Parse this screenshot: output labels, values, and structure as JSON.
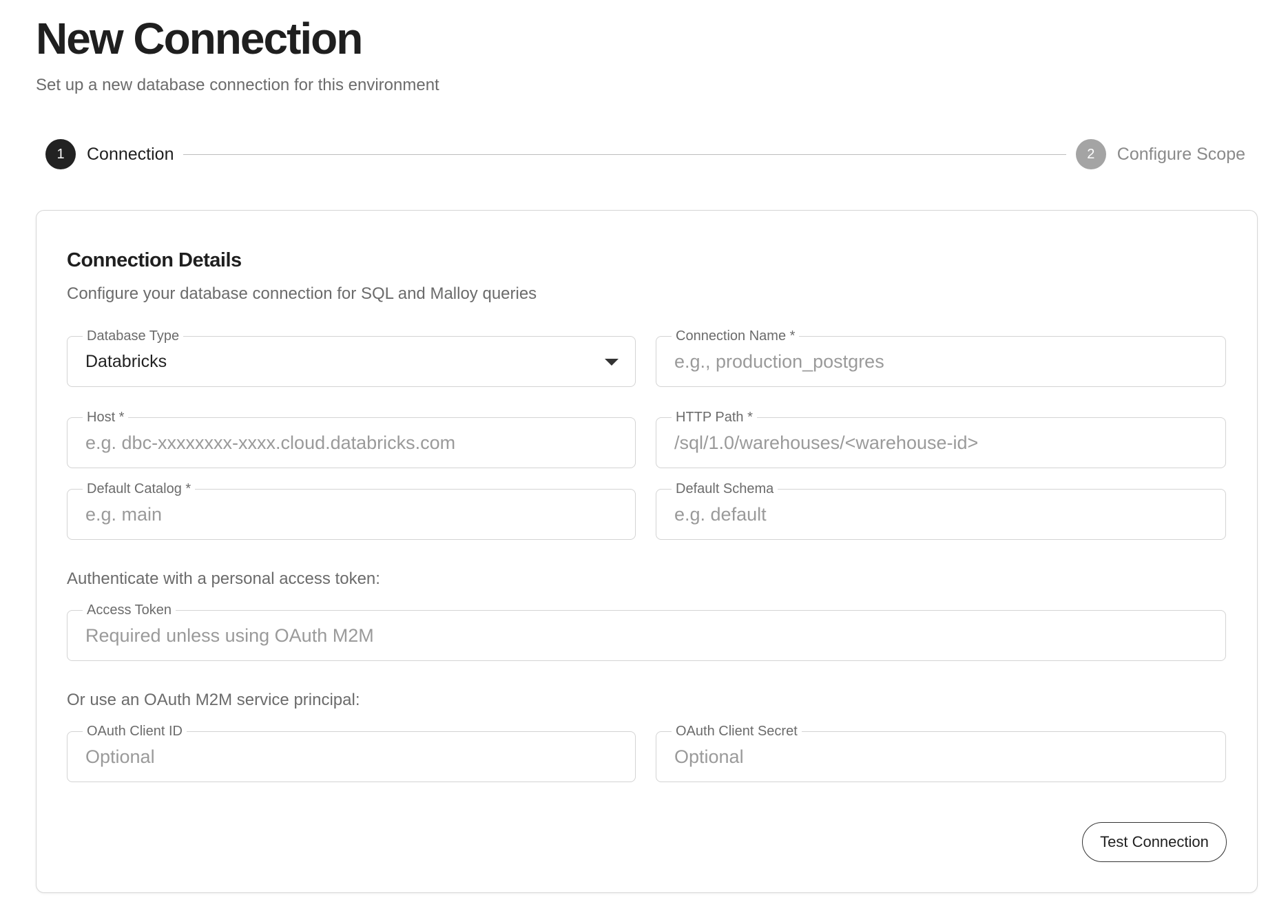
{
  "header": {
    "title": "New Connection",
    "subtitle": "Set up a new database connection for this environment"
  },
  "stepper": {
    "steps": [
      {
        "number": "1",
        "label": "Connection",
        "state": "active"
      },
      {
        "number": "2",
        "label": "Configure Scope",
        "state": "inactive"
      }
    ]
  },
  "card": {
    "title": "Connection Details",
    "subtitle": "Configure your database connection for SQL and Malloy queries",
    "fields": {
      "database_type": {
        "label": "Database Type",
        "value": "Databricks"
      },
      "connection_name": {
        "label": "Connection Name *",
        "value": "",
        "placeholder": "e.g., production_postgres"
      },
      "host": {
        "label": "Host *",
        "value": "",
        "placeholder": "e.g. dbc-xxxxxxxx-xxxx.cloud.databricks.com"
      },
      "http_path": {
        "label": "HTTP Path *",
        "value": "",
        "placeholder": "/sql/1.0/warehouses/<warehouse-id>"
      },
      "default_catalog": {
        "label": "Default Catalog *",
        "value": "",
        "placeholder": "e.g. main"
      },
      "default_schema": {
        "label": "Default Schema",
        "value": "",
        "placeholder": "e.g. default"
      },
      "access_token": {
        "label": "Access Token",
        "value": "",
        "placeholder": "Required unless using OAuth M2M"
      },
      "oauth_client_id": {
        "label": "OAuth Client ID",
        "value": "",
        "placeholder": "Optional"
      },
      "oauth_client_secret": {
        "label": "OAuth Client Secret",
        "value": "",
        "placeholder": "Optional"
      }
    },
    "auth_token_label": "Authenticate with a personal access token:",
    "oauth_label": "Or use an OAuth M2M service principal:",
    "test_button": "Test Connection"
  },
  "colors": {
    "accent": "#222222",
    "inactive_step": "#a4a4a4",
    "border": "#d3d3d3",
    "muted_text": "#6b6b6b",
    "placeholder": "#9a9a9a"
  },
  "icons": {
    "dropdown": "chevron-down-icon"
  }
}
